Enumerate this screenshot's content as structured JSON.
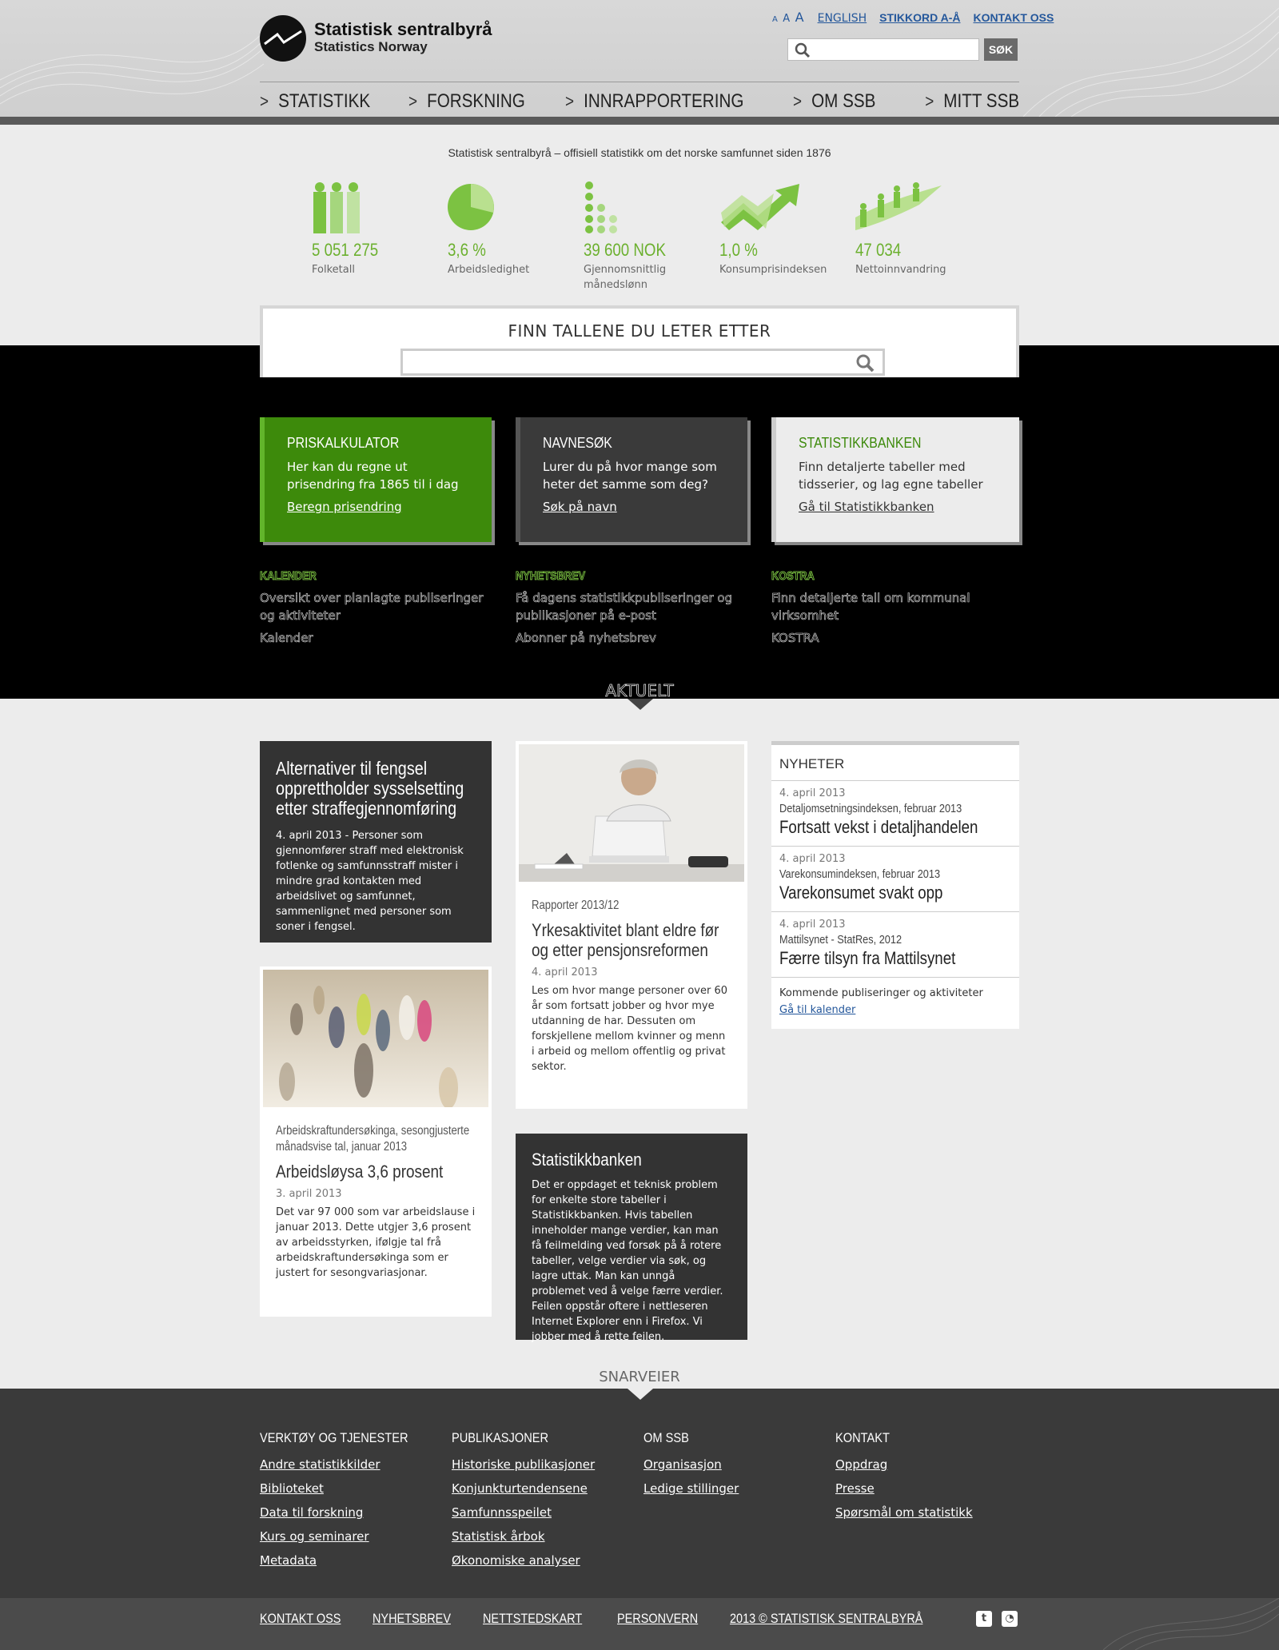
{
  "header": {
    "logo_line1": "Statistisk sentralbyrå",
    "logo_line2": "Statistics Norway",
    "font_sizes": [
      "A",
      "A",
      "A"
    ],
    "english": "ENGLISH",
    "stikkord": "STIKKORD A-Å",
    "kontakt": "KONTAKT OSS",
    "search_placeholder": "",
    "search_button": "SØK",
    "nav": [
      "STATISTIKK",
      "FORSKNING",
      "INNRAPPORTERING",
      "OM SSB",
      "MITT SSB"
    ]
  },
  "tagline": "Statistisk sentralbyrå – offisiell statistikk om det norske samfunnet siden 1876",
  "stats": [
    {
      "value": "5 051 275",
      "label": "Folketall",
      "icon": "people-icon"
    },
    {
      "value": "3,6 %",
      "label": "Arbeidsledighet",
      "icon": "pie-icon"
    },
    {
      "value": "39 600 NOK",
      "label": "Gjennomsnittlig månedslønn",
      "icon": "coins-icon"
    },
    {
      "value": "1,0 %",
      "label": "Konsumprisindeksen",
      "icon": "trend-arrow-icon"
    },
    {
      "value": "47 034",
      "label": "Nettoinnvandring",
      "icon": "migration-icon"
    }
  ],
  "finn": {
    "title": "FINN TALLENE DU LETER ETTER",
    "placeholder": ""
  },
  "tiles": [
    {
      "title": "PRISKALKULATOR",
      "text": "Her kan du regne ut prisendring fra 1865 til i dag",
      "link": "Beregn prisendring"
    },
    {
      "title": "NAVNESØK",
      "text": "Lurer du på hvor mange som heter det samme som deg?",
      "link": "Søk på navn"
    },
    {
      "title": "STATISTIKKBANKEN",
      "text": "Finn detaljerte tabeller med tidsserier, og lag egne tabeller",
      "link": "Gå til Statistikkbanken"
    }
  ],
  "minis": [
    {
      "title": "KALENDER",
      "text": "Oversikt over planlagte publiseringer og aktiviteter",
      "link": "Kalender"
    },
    {
      "title": "NYHETSBREV",
      "text": "Få dagens statistikkpubliseringer og publikasjoner på e-post",
      "link": "Abonner på nyhetsbrev"
    },
    {
      "title": "KOSTRA",
      "text": "Finn detaljerte tall om kommunal virksomhet",
      "link": "KOSTRA"
    }
  ],
  "aktuelt": "AKTUELT",
  "articles": {
    "a1": {
      "title": "Alternativer til fengsel opprettholder sysselsetting etter straffegjennomføring",
      "text": "4. april 2013 - Personer som gjennomfører straff med elektronisk fotlenke og samfunnsstraff mister i mindre grad kontakten med arbeidslivet og samfunnet, sammenlignet med personer som soner i fengsel."
    },
    "a2": {
      "kicker": "Arbeidskraftundersøkinga, sesongjusterte månadsvise tal, januar 2013",
      "title": "Arbeidsløysa 3,6 prosent",
      "date": "3. april 2013",
      "text": "Det var 97 000 som var arbeidslause i januar 2013. Dette utgjer 3,6 prosent av arbeidsstyrken, ifølgje tal frå arbeidskraftundersøkinga som er justert for sesongvariasjonar."
    },
    "a3": {
      "kicker": "Rapporter 2013/12",
      "title": "Yrkesaktivitet blant eldre før og etter pensjonsreformen",
      "date": "4. april 2013",
      "text": "Les om hvor mange personer over 60 år som fortsatt jobber og hvor mye utdanning de har. Dessuten om forskjellene mellom kvinner og menn i arbeid og mellom offentlig og privat sektor."
    },
    "a4": {
      "title": "Statistikkbanken",
      "text": "Det er oppdaget et teknisk problem for enkelte store tabeller i Statistikkbanken. Hvis tabellen inneholder mange verdier, kan man få feilmelding ved forsøk på å rotere tabeller, velge verdier via søk, og lagre uttak. Man kan unngå problemet ved å velge færre verdier. Feilen oppstår oftere i nettleseren Internet Explorer enn i Firefox. Vi jobber med å rette feilen."
    }
  },
  "news": {
    "title": "NYHETER",
    "items": [
      {
        "date": "4. april 2013",
        "kicker": "Detaljomsetningsindeksen, februar 2013",
        "title": "Fortsatt vekst i detaljhandelen"
      },
      {
        "date": "4. april 2013",
        "kicker": "Varekonsumindeksen, februar 2013",
        "title": "Varekonsumet svakt opp"
      },
      {
        "date": "4. april 2013",
        "kicker": "Mattilsynet - StatRes, 2012",
        "title": "Færre tilsyn fra Mattilsynet"
      }
    ],
    "footer_text": "Kommende publiseringer og aktiviteter",
    "footer_link": "Gå til kalender"
  },
  "snarveier": "SNARVEIER",
  "footer": {
    "columns": [
      {
        "title": "VERKTØY OG TJENESTER",
        "links": [
          "Andre statistikkilder",
          "Biblioteket",
          "Data til forskning",
          "Kurs og seminarer",
          "Metadata"
        ]
      },
      {
        "title": "PUBLIKASJONER",
        "links": [
          "Historiske publikasjoner",
          "Konjunkturtendensene",
          "Samfunnsspeilet",
          "Statistisk årbok",
          "Økonomiske analyser"
        ]
      },
      {
        "title": "OM SSB",
        "links": [
          "Organisasjon",
          "Ledige stillinger"
        ]
      },
      {
        "title": "KONTAKT",
        "links": [
          "Oppdrag",
          "Presse",
          "Spørsmål om statistikk"
        ]
      }
    ],
    "bottom": [
      "KONTAKT OSS",
      "NYHETSBREV",
      "NETTSTEDSKART",
      "PERSONVERN",
      "2013 © STATISTISK SENTRALBYRÅ"
    ]
  },
  "colors": {
    "green": "#6bb02e",
    "dark_green": "#3d8a0b",
    "dark": "#3a3a3a",
    "link": "#24579b"
  }
}
